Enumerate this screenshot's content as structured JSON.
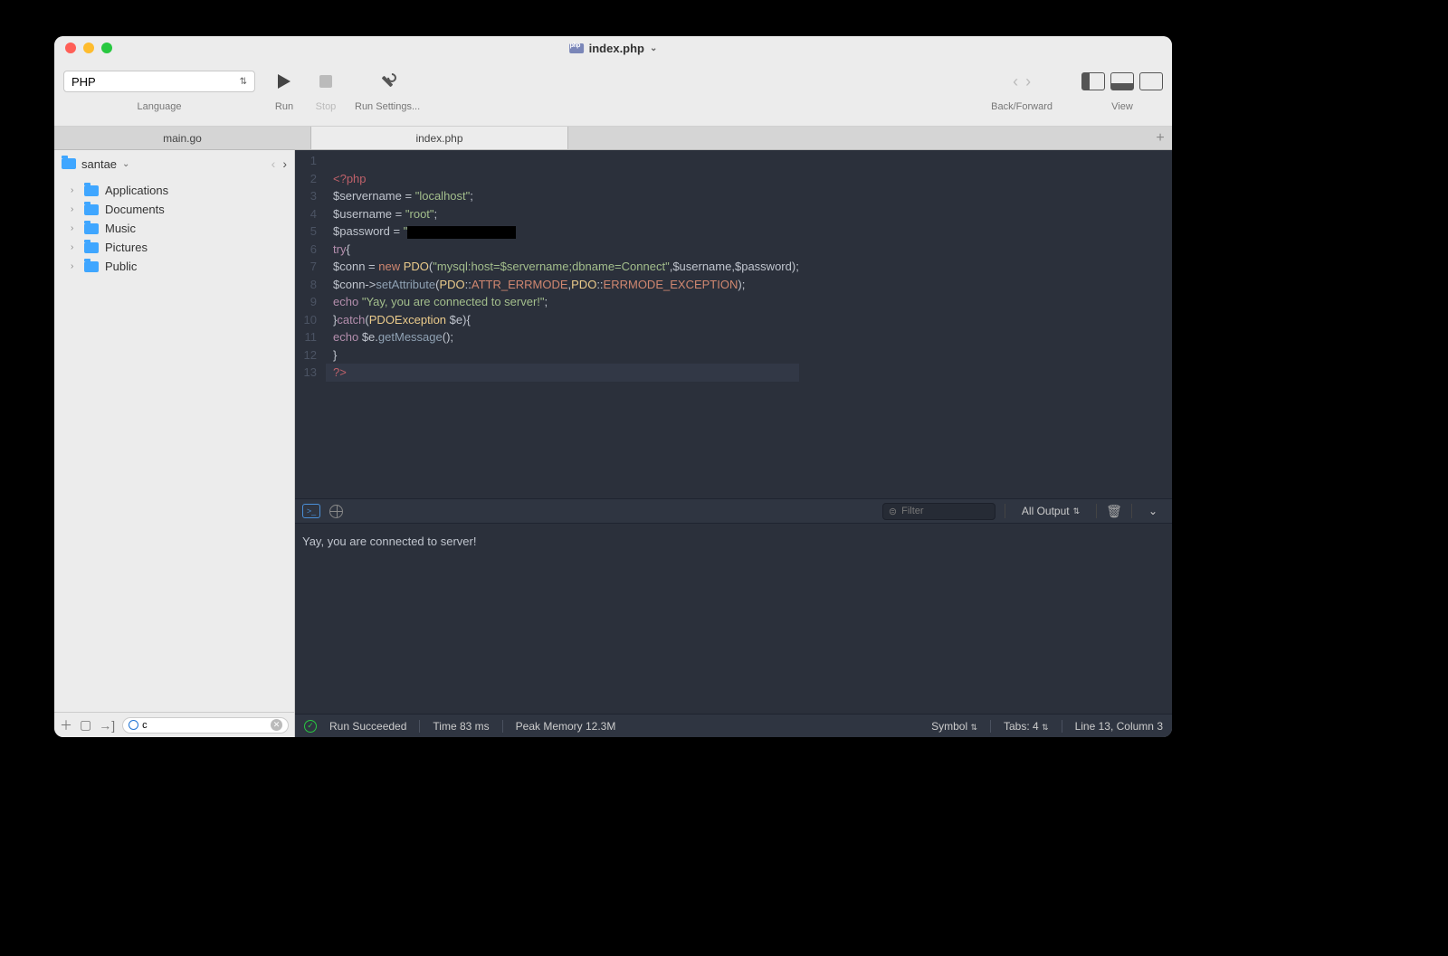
{
  "title": {
    "filename": "index.php"
  },
  "toolbar": {
    "language_value": "PHP",
    "language_label": "Language",
    "run_label": "Run",
    "stop_label": "Stop",
    "settings_label": "Run Settings...",
    "back_forward_label": "Back/Forward",
    "view_label": "View"
  },
  "tabs": [
    {
      "label": "main.go",
      "active": false
    },
    {
      "label": "index.php",
      "active": true
    }
  ],
  "sidebar": {
    "root": "santae",
    "items": [
      "Applications",
      "Documents",
      "Music",
      "Pictures",
      "Public"
    ],
    "search_value": "c"
  },
  "code": {
    "lines": [
      {
        "n": 1,
        "html": ""
      },
      {
        "n": 2,
        "html": "<span class='k-tag'>&lt;?php</span>"
      },
      {
        "n": 3,
        "html": "<span class='k-var'>$servername</span> <span class='k-op'>=</span> <span class='k-str'>\"localhost\"</span><span class='k-punc'>;</span>"
      },
      {
        "n": 4,
        "html": "<span class='k-var'>$username</span> <span class='k-op'>=</span> <span class='k-str'>\"root\"</span><span class='k-punc'>;</span>"
      },
      {
        "n": 5,
        "html": "<span class='k-var'>$password</span> <span class='k-op'>=</span> <span class='k-str'>\"</span><span class='redact'></span>"
      },
      {
        "n": 6,
        "html": "<span class='k-kw'>try</span><span class='k-punc'>{</span>"
      },
      {
        "n": 7,
        "html": "<span class='k-var'>$conn</span> <span class='k-op'>=</span> <span class='k-new'>new</span> <span class='k-cls'>PDO</span><span class='k-punc'>(</span><span class='k-str'>\"mysql:host=$servername;dbname=Connect\"</span><span class='k-punc'>,</span><span class='k-var'>$username</span><span class='k-punc'>,</span><span class='k-var'>$password</span><span class='k-punc'>);</span>"
      },
      {
        "n": 8,
        "html": "<span class='k-var'>$conn</span><span class='k-op'>-&gt;</span><span class='k-func'>setAttribute</span><span class='k-punc'>(</span><span class='k-cls'>PDO</span><span class='k-op'>::</span><span class='k-const'>ATTR_ERRMODE</span><span class='k-punc'>,</span><span class='k-cls'>PDO</span><span class='k-op'>::</span><span class='k-const'>ERRMODE_EXCEPTION</span><span class='k-punc'>);</span>"
      },
      {
        "n": 9,
        "html": "<span class='k-kw'>echo</span> <span class='k-str'>\"Yay, you are connected to server!\"</span><span class='k-punc'>;</span>"
      },
      {
        "n": 10,
        "html": "<span class='k-punc'>}</span><span class='k-kw'>catch</span><span class='k-punc'>(</span><span class='k-cls'>PDOException</span> <span class='k-var'>$e</span><span class='k-punc'>){</span>"
      },
      {
        "n": 11,
        "html": "<span class='k-kw'>echo</span> <span class='k-var'>$e</span><span class='k-op'>.</span><span class='k-func'>getMessage</span><span class='k-punc'>();</span>"
      },
      {
        "n": 12,
        "html": "<span class='k-punc'>}</span>"
      },
      {
        "n": 13,
        "html": "<span class='k-tag'>?&gt;</span>",
        "hl": true
      }
    ]
  },
  "console": {
    "filter_placeholder": "Filter",
    "output_mode": "All Output",
    "text": "Yay, you are connected to server!"
  },
  "status": {
    "run": "Run Succeeded",
    "time": "Time 83 ms",
    "mem": "Peak Memory 12.3M",
    "symbol": "Symbol",
    "tabs": "Tabs: 4",
    "pos": "Line 13, Column 3"
  }
}
